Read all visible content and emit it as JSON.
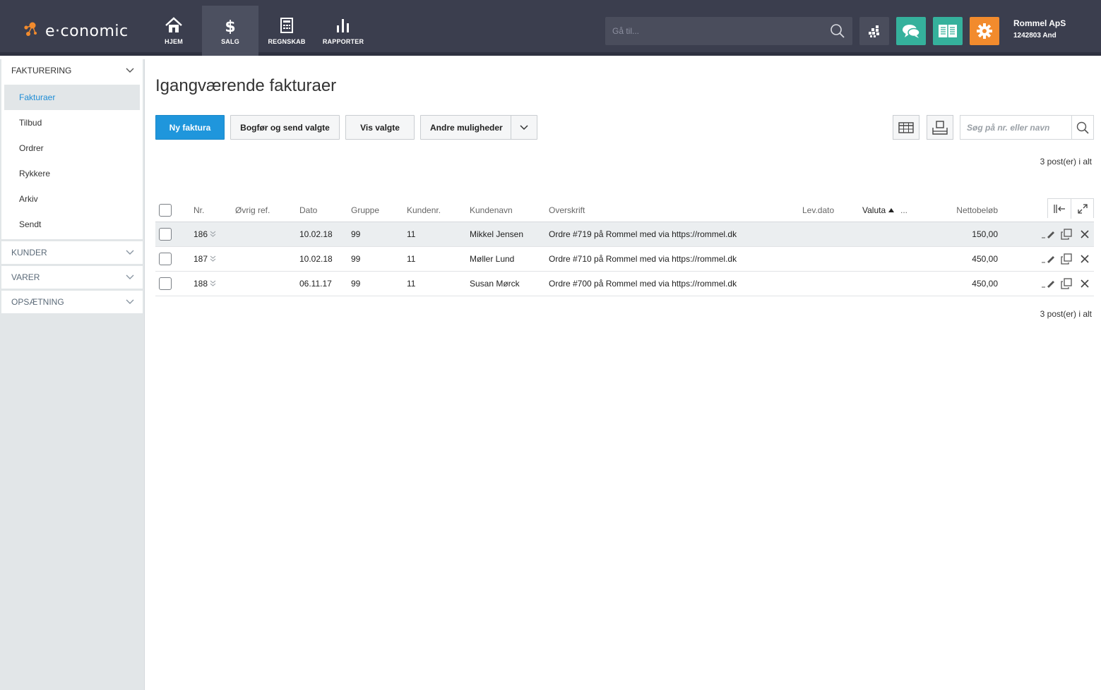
{
  "brand": {
    "name": "e·conomic",
    "accent": "#f28b2d",
    "primary": "#1f96dc"
  },
  "nav": [
    {
      "label": "HJEM",
      "icon": "home-icon"
    },
    {
      "label": "SALG",
      "icon": "dollar-icon",
      "active": true
    },
    {
      "label": "REGNSKAB",
      "icon": "calculator-icon"
    },
    {
      "label": "RAPPORTER",
      "icon": "bar-chart-icon"
    }
  ],
  "goto": {
    "placeholder": "Gå til..."
  },
  "account": {
    "name": "Rommel ApS",
    "id": "1242803 And"
  },
  "sidebar": {
    "fakturering": {
      "label": "FAKTURERING",
      "items": [
        "Fakturaer",
        "Tilbud",
        "Ordrer",
        "Rykkere",
        "Arkiv",
        "Sendt"
      ],
      "active_item": "Fakturaer"
    },
    "kunder": "KUNDER",
    "varer": "VARER",
    "opsaetning": "OPSÆTNING"
  },
  "page": {
    "title": "Igangværende fakturaer",
    "buttons": {
      "new": "Ny faktura",
      "post_send": "Bogfør og send valgte",
      "show": "Vis valgte",
      "other": "Andre muligheder"
    },
    "search_placeholder": "Søg på nr. eller navn",
    "count_top": "3 post(er) i alt",
    "count_bottom": "3 post(er) i alt"
  },
  "table": {
    "columns": {
      "nr": "Nr.",
      "ref": "Øvrig ref.",
      "dato": "Dato",
      "gruppe": "Gruppe",
      "kundenr": "Kundenr.",
      "kundenavn": "Kundenavn",
      "overskrift": "Overskrift",
      "levdato": "Lev.dato",
      "valuta": "Valuta",
      "more": "...",
      "netto": "Nettobeløb"
    },
    "rows": [
      {
        "nr": "186",
        "ref": "",
        "dato": "10.02.18",
        "gruppe": "99",
        "kundenr": "11",
        "kundenavn": "Mikkel Jensen",
        "overskrift": "Ordre #719 på Rommel med via https://rommel.dk",
        "levdato": "",
        "valuta": "",
        "netto": "150,00"
      },
      {
        "nr": "187",
        "ref": "",
        "dato": "10.02.18",
        "gruppe": "99",
        "kundenr": "11",
        "kundenavn": "Møller Lund",
        "overskrift": "Ordre #710 på Rommel med via https://rommel.dk",
        "levdato": "",
        "valuta": "",
        "netto": "450,00"
      },
      {
        "nr": "188",
        "ref": "",
        "dato": "06.11.17",
        "gruppe": "99",
        "kundenr": "11",
        "kundenavn": "Susan Mørck",
        "overskrift": "Ordre #700 på Rommel med via https://rommel.dk",
        "levdato": "",
        "valuta": "",
        "netto": "450,00"
      }
    ]
  }
}
